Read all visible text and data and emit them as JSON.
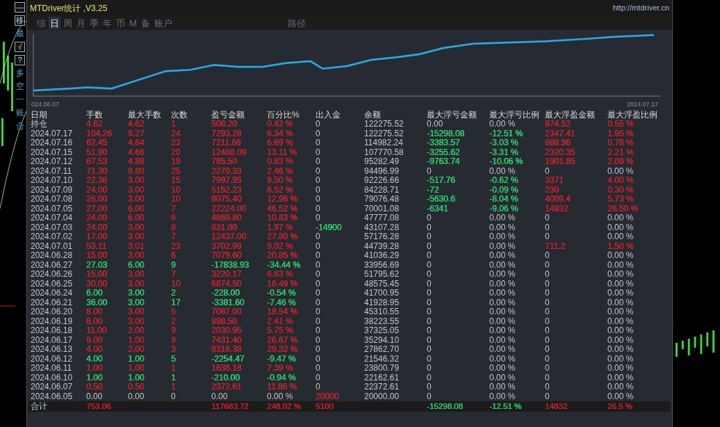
{
  "side_buttons": [
    {
      "label": "—",
      "kind": "boxed"
    },
    {
      "label": "移",
      "kind": "boxed"
    },
    {
      "label": "最",
      "kind": "plain"
    },
    {
      "label": "√",
      "kind": "boxed"
    },
    {
      "label": "?",
      "kind": "boxed"
    },
    {
      "label": "多",
      "kind": "plain"
    },
    {
      "label": "空",
      "kind": "plain"
    },
    {
      "label": "一",
      "kind": "plain"
    },
    {
      "label": "账",
      "kind": "plain"
    },
    {
      "label": "合",
      "kind": "plain"
    }
  ],
  "window": {
    "title": "MTDriver统计 ,V3.25",
    "url": "http://mtdriver.cn"
  },
  "tabs": [
    {
      "label": "综",
      "selected": false
    },
    {
      "label": "日",
      "selected": true
    },
    {
      "label": "周",
      "selected": false
    },
    {
      "label": "月",
      "selected": false
    },
    {
      "label": "季",
      "selected": false
    },
    {
      "label": "年",
      "selected": false
    },
    {
      "label": "币",
      "selected": false
    },
    {
      "label": "M",
      "selected": false
    },
    {
      "label": "备",
      "selected": false
    },
    {
      "label": "账户",
      "selected": false
    }
  ],
  "path_tab": {
    "label": "路径",
    "selected": false
  },
  "equity_chart": {
    "start_label": "024.06.07",
    "end_label": "2024.07.17"
  },
  "table": {
    "columns": [
      "日期",
      "手数",
      "最大手数",
      "次数",
      "盈亏金额",
      "百分比%",
      "出入金",
      "余额",
      "最大浮亏金额",
      "最大浮亏比例",
      "最大浮盈金额",
      "最大浮盈比例"
    ],
    "rows": [
      [
        {
          "text": "持仓"
        },
        {
          "text": "4.62",
          "color": "#d0222c"
        },
        {
          "text": "4.62",
          "color": "#d0222c"
        },
        {
          "text": "1",
          "color": "#d0222c"
        },
        {
          "text": "508.20",
          "color": "#d0222c"
        },
        {
          "text": "0.42 %",
          "color": "#d0222c"
        },
        {
          "text": "0"
        },
        {
          "text": "122275.52"
        },
        {
          "text": "0.00"
        },
        {
          "text": "0.00 %"
        },
        {
          "text": "874.52",
          "color": "#d0222c"
        },
        {
          "text": "0.55 %",
          "color": "#d0222c"
        }
      ],
      [
        {
          "text": "2024.07.17"
        },
        {
          "text": "104.26",
          "color": "#d0222c"
        },
        {
          "text": "9.27",
          "color": "#d0222c"
        },
        {
          "text": "24",
          "color": "#d0222c"
        },
        {
          "text": "7293.28",
          "color": "#d0222c"
        },
        {
          "text": "6.34 %",
          "color": "#d0222c"
        },
        {
          "text": "0"
        },
        {
          "text": "122275.52"
        },
        {
          "text": "-15298.08",
          "color": "#2fd070"
        },
        {
          "text": "-12.51 %",
          "color": "#2fd070"
        },
        {
          "text": "2347.41",
          "color": "#d0222c"
        },
        {
          "text": "1.95 %",
          "color": "#d0222c"
        }
      ],
      [
        {
          "text": "2024.07.16"
        },
        {
          "text": "62.45",
          "color": "#d0222c"
        },
        {
          "text": "4.64",
          "color": "#d0222c"
        },
        {
          "text": "23",
          "color": "#d0222c"
        },
        {
          "text": "7211.66",
          "color": "#d0222c"
        },
        {
          "text": "6.69 %",
          "color": "#d0222c"
        },
        {
          "text": "0"
        },
        {
          "text": "114982.24"
        },
        {
          "text": "-3383.57",
          "color": "#2fd070"
        },
        {
          "text": "-3.03 %",
          "color": "#2fd070"
        },
        {
          "text": "888.96",
          "color": "#d0222c"
        },
        {
          "text": "0.78 %",
          "color": "#d0222c"
        }
      ],
      [
        {
          "text": "2024.07.15"
        },
        {
          "text": "51.90",
          "color": "#d0222c"
        },
        {
          "text": "4.66",
          "color": "#d0222c"
        },
        {
          "text": "20",
          "color": "#d0222c"
        },
        {
          "text": "12488.09",
          "color": "#d0222c"
        },
        {
          "text": "13.11 %",
          "color": "#d0222c"
        },
        {
          "text": "0"
        },
        {
          "text": "107770.58"
        },
        {
          "text": "-3255.62",
          "color": "#2fd070"
        },
        {
          "text": "-3.31 %",
          "color": "#2fd070"
        },
        {
          "text": "2320.35",
          "color": "#d0222c"
        },
        {
          "text": "2.21 %",
          "color": "#d0222c"
        }
      ],
      [
        {
          "text": "2024.07.12"
        },
        {
          "text": "67.53",
          "color": "#d0222c"
        },
        {
          "text": "4.88",
          "color": "#d0222c"
        },
        {
          "text": "19",
          "color": "#d0222c"
        },
        {
          "text": "785.50",
          "color": "#d0222c"
        },
        {
          "text": "0.83 %",
          "color": "#d0222c"
        },
        {
          "text": "0"
        },
        {
          "text": "95282.49"
        },
        {
          "text": "-9763.74",
          "color": "#2fd070"
        },
        {
          "text": "-10.06 %",
          "color": "#2fd070"
        },
        {
          "text": "1901.85",
          "color": "#d0222c"
        },
        {
          "text": "2.09 %",
          "color": "#d0222c"
        }
      ],
      [
        {
          "text": "2024.07.11"
        },
        {
          "text": "71.30",
          "color": "#d0222c"
        },
        {
          "text": "9.80",
          "color": "#d0222c"
        },
        {
          "text": "25",
          "color": "#d0222c"
        },
        {
          "text": "2270.33",
          "color": "#d0222c"
        },
        {
          "text": "2.46 %",
          "color": "#d0222c"
        },
        {
          "text": "0"
        },
        {
          "text": "94496.99"
        },
        {
          "text": "0"
        },
        {
          "text": "0.00 %"
        },
        {
          "text": "0"
        },
        {
          "text": "0.00 %"
        }
      ],
      [
        {
          "text": "2024.07.10"
        },
        {
          "text": "22.36",
          "color": "#d0222c"
        },
        {
          "text": "3.00",
          "color": "#d0222c"
        },
        {
          "text": "15",
          "color": "#d0222c"
        },
        {
          "text": "7997.95",
          "color": "#d0222c"
        },
        {
          "text": "9.50 %",
          "color": "#d0222c"
        },
        {
          "text": "0"
        },
        {
          "text": "92226.66"
        },
        {
          "text": "-517.76",
          "color": "#2fd070"
        },
        {
          "text": "-0.62 %",
          "color": "#2fd070"
        },
        {
          "text": "3371",
          "color": "#d0222c"
        },
        {
          "text": "4.00 %",
          "color": "#d0222c"
        }
      ],
      [
        {
          "text": "2024.07.09"
        },
        {
          "text": "24.00",
          "color": "#d0222c"
        },
        {
          "text": "3.00",
          "color": "#d0222c"
        },
        {
          "text": "10",
          "color": "#d0222c"
        },
        {
          "text": "5152.23",
          "color": "#d0222c"
        },
        {
          "text": "6.52 %",
          "color": "#d0222c"
        },
        {
          "text": "0"
        },
        {
          "text": "84228.71"
        },
        {
          "text": "-72",
          "color": "#2fd070"
        },
        {
          "text": "-0.09 %",
          "color": "#2fd070"
        },
        {
          "text": "230",
          "color": "#d0222c"
        },
        {
          "text": "0.30 %",
          "color": "#d0222c"
        }
      ],
      [
        {
          "text": "2024.07.08"
        },
        {
          "text": "26.00",
          "color": "#d0222c"
        },
        {
          "text": "3.00",
          "color": "#d0222c"
        },
        {
          "text": "10",
          "color": "#d0222c"
        },
        {
          "text": "9075.40",
          "color": "#d0222c"
        },
        {
          "text": "12.96 %",
          "color": "#d0222c"
        },
        {
          "text": "0"
        },
        {
          "text": "79076.48"
        },
        {
          "text": "-5630.6",
          "color": "#2fd070"
        },
        {
          "text": "-8.04 %",
          "color": "#2fd070"
        },
        {
          "text": "4009.4",
          "color": "#d0222c"
        },
        {
          "text": "5.73 %",
          "color": "#d0222c"
        }
      ],
      [
        {
          "text": "2024.07.05"
        },
        {
          "text": "27.00",
          "color": "#d0222c"
        },
        {
          "text": "6.00",
          "color": "#d0222c"
        },
        {
          "text": "7",
          "color": "#d0222c"
        },
        {
          "text": "22224.00",
          "color": "#d0222c"
        },
        {
          "text": "46.52 %",
          "color": "#d0222c"
        },
        {
          "text": "0"
        },
        {
          "text": "70001.08"
        },
        {
          "text": "-6341",
          "color": "#2fd070"
        },
        {
          "text": "-9.06 %",
          "color": "#2fd070"
        },
        {
          "text": "14832",
          "color": "#d0222c"
        },
        {
          "text": "26.50 %",
          "color": "#d0222c"
        }
      ],
      [
        {
          "text": "2024.07.04"
        },
        {
          "text": "24.00",
          "color": "#d0222c"
        },
        {
          "text": "6.00",
          "color": "#d0222c"
        },
        {
          "text": "6",
          "color": "#d0222c"
        },
        {
          "text": "4869.80",
          "color": "#d0222c"
        },
        {
          "text": "10.83 %",
          "color": "#d0222c"
        },
        {
          "text": "0"
        },
        {
          "text": "47777.08"
        },
        {
          "text": "0"
        },
        {
          "text": "0.00 %"
        },
        {
          "text": "0"
        },
        {
          "text": "0.00 %"
        }
      ],
      [
        {
          "text": "2024.07.03"
        },
        {
          "text": "24.00",
          "color": "#d0222c"
        },
        {
          "text": "3.00",
          "color": "#d0222c"
        },
        {
          "text": "8",
          "color": "#d0222c"
        },
        {
          "text": "831.00",
          "color": "#d0222c"
        },
        {
          "text": "1.97 %",
          "color": "#d0222c"
        },
        {
          "text": "-14900",
          "color": "#2fd070"
        },
        {
          "text": "43107.28"
        },
        {
          "text": "0"
        },
        {
          "text": "0.00 %"
        },
        {
          "text": "0"
        },
        {
          "text": "0.00 %"
        }
      ],
      [
        {
          "text": "2024.07.02"
        },
        {
          "text": "17.00",
          "color": "#d0222c"
        },
        {
          "text": "3.00",
          "color": "#d0222c"
        },
        {
          "text": "7",
          "color": "#d0222c"
        },
        {
          "text": "12437.00",
          "color": "#d0222c"
        },
        {
          "text": "27.80 %",
          "color": "#d0222c"
        },
        {
          "text": "0"
        },
        {
          "text": "57176.28"
        },
        {
          "text": "0"
        },
        {
          "text": "0.00 %"
        },
        {
          "text": "0"
        },
        {
          "text": "0.00 %"
        }
      ],
      [
        {
          "text": "2024.07.01"
        },
        {
          "text": "53.11",
          "color": "#d0222c"
        },
        {
          "text": "3.01",
          "color": "#d0222c"
        },
        {
          "text": "23",
          "color": "#d0222c"
        },
        {
          "text": "3702.99",
          "color": "#d0222c"
        },
        {
          "text": "9.02 %",
          "color": "#d0222c"
        },
        {
          "text": "0"
        },
        {
          "text": "44739.28"
        },
        {
          "text": "0"
        },
        {
          "text": "0.00 %"
        },
        {
          "text": "711.2",
          "color": "#d0222c"
        },
        {
          "text": "1.50 %",
          "color": "#d0222c"
        }
      ],
      [
        {
          "text": "2024.06.28"
        },
        {
          "text": "15.00",
          "color": "#d0222c"
        },
        {
          "text": "3.00",
          "color": "#d0222c"
        },
        {
          "text": "6",
          "color": "#d0222c"
        },
        {
          "text": "7079.60",
          "color": "#d0222c"
        },
        {
          "text": "20.85 %",
          "color": "#d0222c"
        },
        {
          "text": "0"
        },
        {
          "text": "41036.29"
        },
        {
          "text": "0"
        },
        {
          "text": "0.00 %"
        },
        {
          "text": "0"
        },
        {
          "text": "0.00 %"
        }
      ],
      [
        {
          "text": "2024.06.27"
        },
        {
          "text": "27.03",
          "color": "#2fd070"
        },
        {
          "text": "6.00",
          "color": "#2fd070"
        },
        {
          "text": "9",
          "color": "#2fd070"
        },
        {
          "text": "-17838.93",
          "color": "#2fd070"
        },
        {
          "text": "-34.44 %",
          "color": "#2fd070"
        },
        {
          "text": "0"
        },
        {
          "text": "33956.69"
        },
        {
          "text": "0"
        },
        {
          "text": "0.00 %"
        },
        {
          "text": "0"
        },
        {
          "text": "0.00 %"
        }
      ],
      [
        {
          "text": "2024.06.26"
        },
        {
          "text": "15.00",
          "color": "#d0222c"
        },
        {
          "text": "3.00",
          "color": "#d0222c"
        },
        {
          "text": "7",
          "color": "#d0222c"
        },
        {
          "text": "3220.17",
          "color": "#d0222c"
        },
        {
          "text": "6.63 %",
          "color": "#d0222c"
        },
        {
          "text": "0"
        },
        {
          "text": "51795.62"
        },
        {
          "text": "0"
        },
        {
          "text": "0.00 %"
        },
        {
          "text": "0"
        },
        {
          "text": "0.00 %"
        }
      ],
      [
        {
          "text": "2024.06.25"
        },
        {
          "text": "30.00",
          "color": "#d0222c"
        },
        {
          "text": "3.00",
          "color": "#d0222c"
        },
        {
          "text": "10",
          "color": "#d0222c"
        },
        {
          "text": "6874.50",
          "color": "#d0222c"
        },
        {
          "text": "16.49 %",
          "color": "#d0222c"
        },
        {
          "text": "0"
        },
        {
          "text": "48575.45"
        },
        {
          "text": "0"
        },
        {
          "text": "0.00 %"
        },
        {
          "text": "0"
        },
        {
          "text": "0.00 %"
        }
      ],
      [
        {
          "text": "2024.06.24"
        },
        {
          "text": "6.00",
          "color": "#2fd070"
        },
        {
          "text": "3.00",
          "color": "#2fd070"
        },
        {
          "text": "2",
          "color": "#2fd070"
        },
        {
          "text": "-228.00",
          "color": "#2fd070"
        },
        {
          "text": "-0.54 %",
          "color": "#2fd070"
        },
        {
          "text": "0"
        },
        {
          "text": "41700.95"
        },
        {
          "text": "0"
        },
        {
          "text": "0.00 %"
        },
        {
          "text": "0"
        },
        {
          "text": "0.00 %"
        }
      ],
      [
        {
          "text": "2024.06.21"
        },
        {
          "text": "36.00",
          "color": "#2fd070"
        },
        {
          "text": "3.00",
          "color": "#2fd070"
        },
        {
          "text": "17",
          "color": "#2fd070"
        },
        {
          "text": "-3381.60",
          "color": "#2fd070"
        },
        {
          "text": "-7.46 %",
          "color": "#2fd070"
        },
        {
          "text": "0"
        },
        {
          "text": "41928.95"
        },
        {
          "text": "0"
        },
        {
          "text": "0.00 %"
        },
        {
          "text": "0"
        },
        {
          "text": "0.00 %"
        }
      ],
      [
        {
          "text": "2024.06.20"
        },
        {
          "text": "8.00",
          "color": "#d0222c"
        },
        {
          "text": "3.00",
          "color": "#d0222c"
        },
        {
          "text": "5",
          "color": "#d0222c"
        },
        {
          "text": "7087.00",
          "color": "#d0222c"
        },
        {
          "text": "18.54 %",
          "color": "#d0222c"
        },
        {
          "text": "0"
        },
        {
          "text": "45310.55"
        },
        {
          "text": "0"
        },
        {
          "text": "0.00 %"
        },
        {
          "text": "0"
        },
        {
          "text": "0.00 %"
        }
      ],
      [
        {
          "text": "2024.06.19"
        },
        {
          "text": "6.00",
          "color": "#d0222c"
        },
        {
          "text": "3.00",
          "color": "#d0222c"
        },
        {
          "text": "2",
          "color": "#d0222c"
        },
        {
          "text": "898.50",
          "color": "#d0222c"
        },
        {
          "text": "2.41 %",
          "color": "#d0222c"
        },
        {
          "text": "0"
        },
        {
          "text": "38223.55"
        },
        {
          "text": "0"
        },
        {
          "text": "0.00 %"
        },
        {
          "text": "0"
        },
        {
          "text": "0.00 %"
        }
      ],
      [
        {
          "text": "2024.06.18"
        },
        {
          "text": "11.00",
          "color": "#d0222c"
        },
        {
          "text": "2.00",
          "color": "#d0222c"
        },
        {
          "text": "9",
          "color": "#d0222c"
        },
        {
          "text": "2030.95",
          "color": "#d0222c"
        },
        {
          "text": "5.75 %",
          "color": "#d0222c"
        },
        {
          "text": "0"
        },
        {
          "text": "37325.05"
        },
        {
          "text": "0"
        },
        {
          "text": "0.00 %"
        },
        {
          "text": "0"
        },
        {
          "text": "0.00 %"
        }
      ],
      [
        {
          "text": "2024.06.17"
        },
        {
          "text": "9.00",
          "color": "#d0222c"
        },
        {
          "text": "1.00",
          "color": "#d0222c"
        },
        {
          "text": "9",
          "color": "#d0222c"
        },
        {
          "text": "7431.40",
          "color": "#d0222c"
        },
        {
          "text": "26.67 %",
          "color": "#d0222c"
        },
        {
          "text": "0"
        },
        {
          "text": "35294.10"
        },
        {
          "text": "0"
        },
        {
          "text": "0.00 %"
        },
        {
          "text": "0"
        },
        {
          "text": "0.00 %"
        }
      ],
      [
        {
          "text": "2024.06.13"
        },
        {
          "text": "4.00",
          "color": "#d0222c"
        },
        {
          "text": "2.00",
          "color": "#d0222c"
        },
        {
          "text": "3",
          "color": "#d0222c"
        },
        {
          "text": "8316.38",
          "color": "#d0222c"
        },
        {
          "text": "29.32 %",
          "color": "#d0222c"
        },
        {
          "text": "0"
        },
        {
          "text": "27862.70"
        },
        {
          "text": "0"
        },
        {
          "text": "0.00 %"
        },
        {
          "text": "0"
        },
        {
          "text": "0.00 %"
        }
      ],
      [
        {
          "text": "2024.06.12"
        },
        {
          "text": "4.00",
          "color": "#2fd070"
        },
        {
          "text": "1.00",
          "color": "#2fd070"
        },
        {
          "text": "5",
          "color": "#2fd070"
        },
        {
          "text": "-2254.47",
          "color": "#2fd070"
        },
        {
          "text": "-9.47 %",
          "color": "#2fd070"
        },
        {
          "text": "0"
        },
        {
          "text": "21546.32"
        },
        {
          "text": "0"
        },
        {
          "text": "0.00 %"
        },
        {
          "text": "0"
        },
        {
          "text": "0.00 %"
        }
      ],
      [
        {
          "text": "2024.06.11"
        },
        {
          "text": "1.00",
          "color": "#d0222c"
        },
        {
          "text": "1.00",
          "color": "#d0222c"
        },
        {
          "text": "1",
          "color": "#d0222c"
        },
        {
          "text": "1638.18",
          "color": "#d0222c"
        },
        {
          "text": "7.39 %",
          "color": "#d0222c"
        },
        {
          "text": "0"
        },
        {
          "text": "23800.79"
        },
        {
          "text": "0"
        },
        {
          "text": "0.00 %"
        },
        {
          "text": "0"
        },
        {
          "text": "0.00 %"
        }
      ],
      [
        {
          "text": "2024.06.10"
        },
        {
          "text": "1.00",
          "color": "#2fd070"
        },
        {
          "text": "1.00",
          "color": "#2fd070"
        },
        {
          "text": "1",
          "color": "#2fd070"
        },
        {
          "text": "-210.00",
          "color": "#2fd070"
        },
        {
          "text": "-0.94 %",
          "color": "#2fd070"
        },
        {
          "text": "0"
        },
        {
          "text": "22162.61"
        },
        {
          "text": "0"
        },
        {
          "text": "0.00 %"
        },
        {
          "text": "0"
        },
        {
          "text": "0.00 %"
        }
      ],
      [
        {
          "text": "2024.06.07"
        },
        {
          "text": "0.50",
          "color": "#d0222c"
        },
        {
          "text": "0.50",
          "color": "#d0222c"
        },
        {
          "text": "1",
          "color": "#d0222c"
        },
        {
          "text": "2372.61",
          "color": "#d0222c"
        },
        {
          "text": "11.86 %",
          "color": "#d0222c"
        },
        {
          "text": "0"
        },
        {
          "text": "22372.61"
        },
        {
          "text": "0"
        },
        {
          "text": "0.00 %"
        },
        {
          "text": "0"
        },
        {
          "text": "0.00 %"
        }
      ],
      [
        {
          "text": "2024.06.05"
        },
        {
          "text": "0.00"
        },
        {
          "text": "0.00"
        },
        {
          "text": "0"
        },
        {
          "text": "0.00"
        },
        {
          "text": "0.00 %"
        },
        {
          "text": "20000",
          "color": "#d0222c"
        },
        {
          "text": "20000.00"
        },
        {
          "text": "0"
        },
        {
          "text": "0.00 %"
        },
        {
          "text": "0"
        },
        {
          "text": "0.00 %"
        }
      ]
    ],
    "total": {
      "label": {
        "text": "合计"
      },
      "lots": {
        "text": "753.06",
        "color": "#d0222c"
      },
      "profit": {
        "text": "117683.72",
        "color": "#d0222c"
      },
      "percent": {
        "text": "248.02 %",
        "color": "#d0222c"
      },
      "deposit": {
        "text": "5100",
        "color": "#d0222c"
      },
      "max_float_loss": {
        "text": "-15298.08",
        "color": "#2fd070"
      },
      "max_float_loss_ratio": {
        "text": "-12.51 %",
        "color": "#2fd070"
      },
      "max_float_profit": {
        "text": "14832",
        "color": "#d0222c"
      },
      "max_float_profit_ratio": {
        "text": "26.5 %",
        "color": "#d0222c"
      }
    }
  }
}
